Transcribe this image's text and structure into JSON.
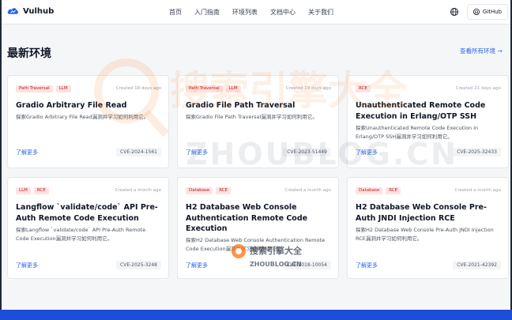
{
  "brand": {
    "name": "Vulhub"
  },
  "nav": {
    "items": [
      "首页",
      "入门指南",
      "环境列表",
      "文档中心",
      "关于我们"
    ]
  },
  "header": {
    "github_label": "GitHub"
  },
  "section": {
    "title": "最新环境",
    "view_all": "查看所有环境 →"
  },
  "cards": [
    {
      "tags": [
        "Path Traversal",
        "LLM"
      ],
      "time": "Created 18 days ago",
      "title": "Gradio Arbitrary File Read",
      "desc": "探索Gradio Arbitrary File Read漏洞并学习如何利用它。",
      "learn_more": "了解更多",
      "cve": "CVE-2024-1561"
    },
    {
      "tags": [
        "Path Traversal",
        "LLM"
      ],
      "time": "Created 19 days ago",
      "title": "Gradio File Path Traversal",
      "desc": "探索Gradio File Path Traversal漏洞并学习如何利用它。",
      "learn_more": "了解更多",
      "cve": "CVE-2023-51449"
    },
    {
      "tags": [
        "RCE"
      ],
      "time": "Created 21 days ago",
      "title": "Unauthenticated Remote Code Execution in Erlang/OTP SSH",
      "desc": "探索Unauthenticated Remote Code Execution in Erlang/OTP SSH漏洞并学习如何利用它。",
      "learn_more": "了解更多",
      "cve": "CVE-2025-32433"
    },
    {
      "tags": [
        "LLM",
        "RCE"
      ],
      "time": "Created a month ago",
      "title": "Langflow `validate/code` API Pre-Auth Remote Code Execution",
      "desc": "探索Langflow `validate/code` API Pre-Auth Remote Code Execution漏洞并学习如何利用它。",
      "learn_more": "了解更多",
      "cve": "CVE-2025-3248"
    },
    {
      "tags": [
        "Database",
        "RCE"
      ],
      "time": "Created a month ago",
      "title": "H2 Database Web Console Authentication Remote Code Execution",
      "desc": "探索H2 Database Web Console Authentication Remote Code Execution漏洞并学习如何利用它。",
      "learn_more": "了解更多",
      "cve": "CVE-2018-10054"
    },
    {
      "tags": [
        "Database",
        "RCE"
      ],
      "time": "Created a month ago",
      "title": "H2 Database Web Console Pre-Auth JNDI Injection RCE",
      "desc": "探索H2 Database Web Console Pre-Auth JNDI Injection RCE漏洞并学习如何利用它。",
      "learn_more": "了解更多",
      "cve": "CVE-2021-42392"
    }
  ],
  "watermarks": {
    "main_text": "搜索引擎大全",
    "url_text": "ZHOUBLOG.CN",
    "small_text": "搜索引擎大全",
    "small_url": "ZHOUBLOG.CN"
  },
  "colors": {
    "accent": "#2563eb",
    "tag_bg": "#fee2e2",
    "tag_text": "#b91c1c",
    "footer": "#1d4ed8"
  }
}
